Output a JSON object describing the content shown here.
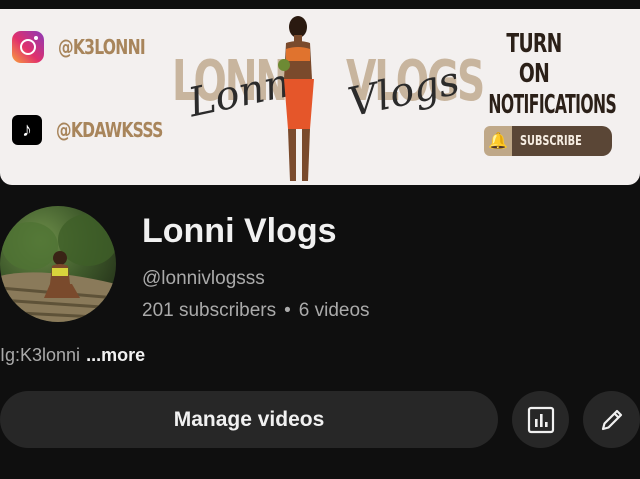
{
  "banner": {
    "instagram_handle": "@K3LONNI",
    "tiktok_handle": "@KDAWKSSS",
    "brand_left": "LONNI",
    "brand_right": "VLOGS",
    "script_left": "Lonni",
    "script_right": "Vlogs",
    "notify_line1": "TURN ON",
    "notify_line2": "NOTIFICATIONS",
    "subscribe_label": "SUBSCRIBE",
    "instagram_icon": "instagram-icon",
    "tiktok_icon": "tiktok-icon",
    "bell_icon": "bell-icon",
    "colors": {
      "background": "#f3f0ef",
      "brand_text": "#c8b59e",
      "handle_text": "#a8855b",
      "subscribe_pill": "#5a4636"
    }
  },
  "channel": {
    "name": "Lonni Vlogs",
    "handle": "@lonnivlogsss",
    "subscribers": "201 subscribers",
    "separator": "•",
    "videos": "6 videos",
    "description": "Ig:K3lonni",
    "more_label": "...more"
  },
  "actions": {
    "manage_videos_label": "Manage videos",
    "analytics_icon": "analytics-icon",
    "edit_icon": "pencil-icon"
  },
  "theme": {
    "page_background": "#0f0f0f",
    "button_background": "#272727",
    "primary_text": "#f1f1f1",
    "secondary_text": "#aaaaaa"
  }
}
